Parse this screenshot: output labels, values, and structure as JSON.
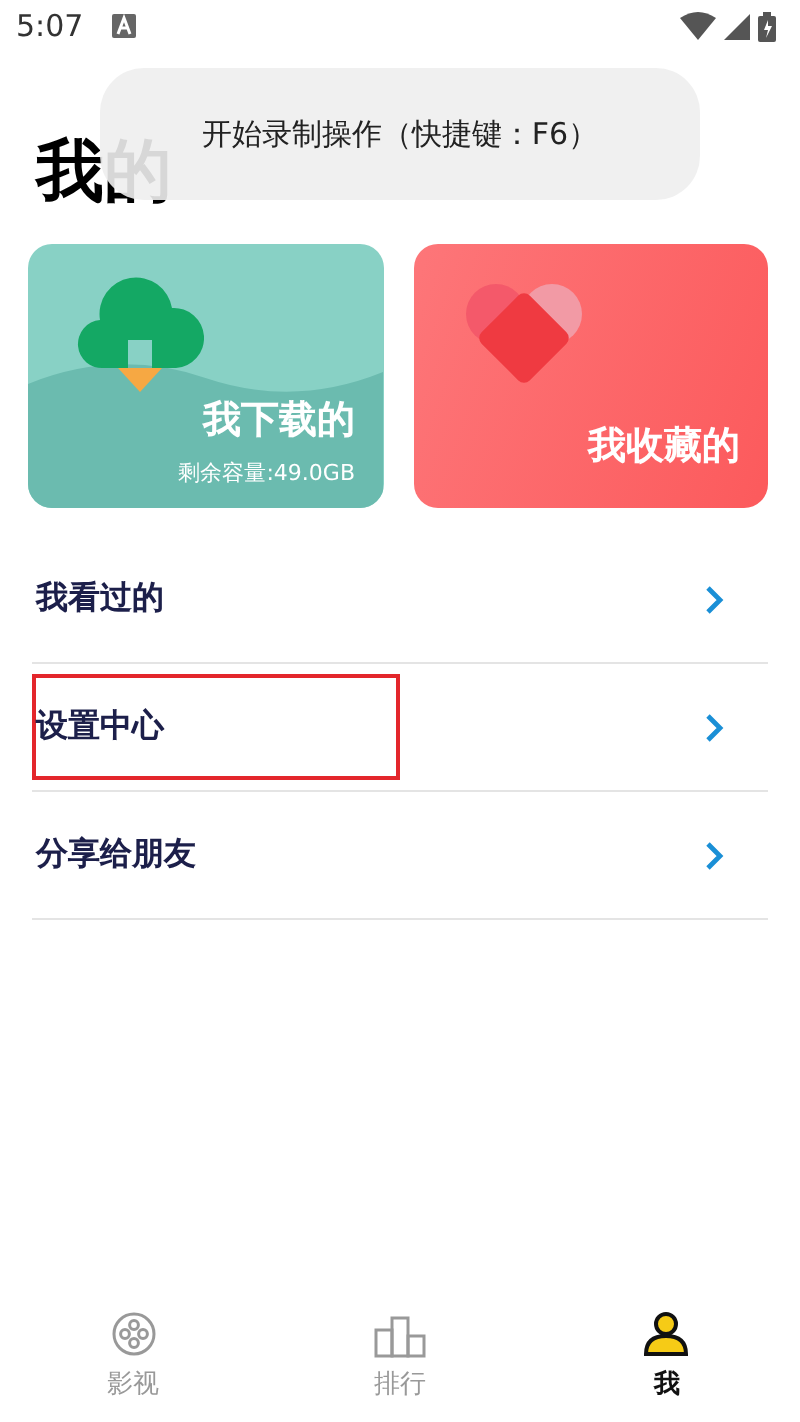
{
  "status_bar": {
    "time": "5:07"
  },
  "toast": {
    "text": "开始录制操作（快捷键：F6）"
  },
  "title": "我的",
  "cards": [
    {
      "kind": "download",
      "title": "我下载的",
      "subtitle": "剩余容量:49.0GB"
    },
    {
      "kind": "favorite",
      "title": "我收藏的"
    }
  ],
  "menu": [
    {
      "label": "我看过的",
      "highlighted": false
    },
    {
      "label": "设置中心",
      "highlighted": true
    },
    {
      "label": "分享给朋友",
      "highlighted": false
    }
  ],
  "tabs": [
    {
      "kind": "film",
      "label": "影视",
      "selected": false
    },
    {
      "kind": "rank",
      "label": "排行",
      "selected": false
    },
    {
      "kind": "me",
      "label": "我",
      "selected": true
    }
  ]
}
